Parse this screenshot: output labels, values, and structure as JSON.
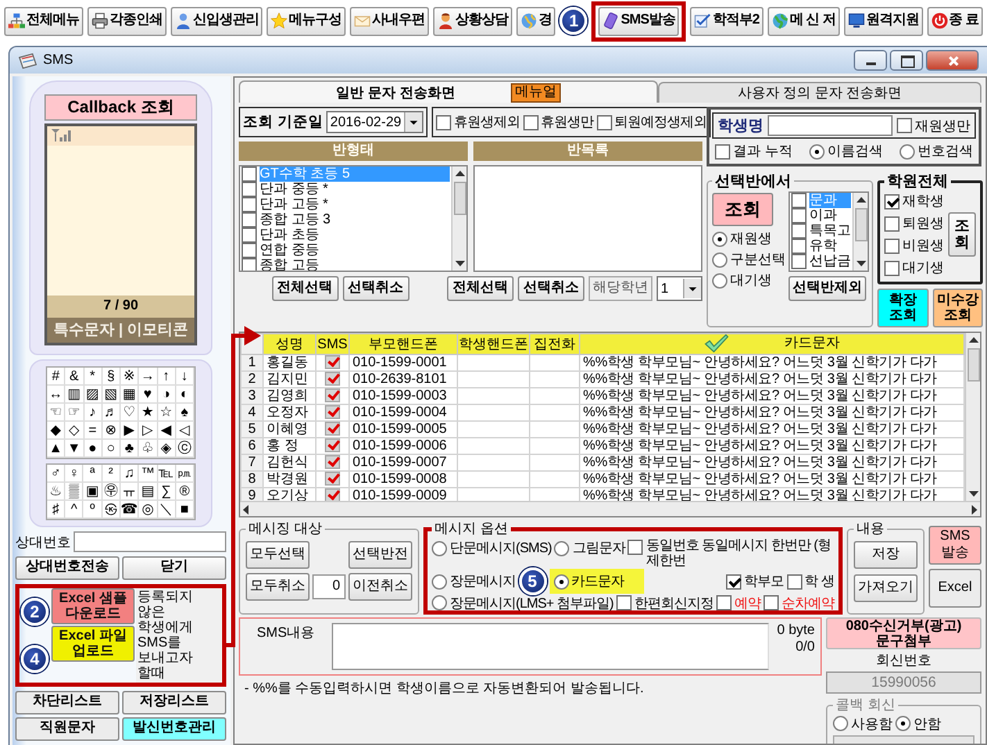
{
  "toolbar": {
    "items": [
      {
        "label": "전체메뉴",
        "highlighted": false
      },
      {
        "label": "각종인쇄",
        "highlighted": false
      },
      {
        "label": "신입생관리",
        "highlighted": false
      },
      {
        "label": "메뉴구성",
        "highlighted": false
      },
      {
        "label": "사내우편",
        "highlighted": false
      },
      {
        "label": "상황상담",
        "highlighted": false
      },
      {
        "label": "경",
        "highlighted": false
      },
      {
        "label": "SMS발송",
        "highlighted": true
      },
      {
        "label": "학적부2",
        "highlighted": false
      },
      {
        "label": "메 신 저",
        "highlighted": false
      },
      {
        "label": "원격지원",
        "highlighted": false
      },
      {
        "label": "종 료",
        "highlighted": false
      }
    ]
  },
  "callouts": [
    {
      "number": "1"
    },
    {
      "number": "2"
    },
    {
      "number": "4"
    },
    {
      "number": "5"
    }
  ],
  "window": {
    "title": "SMS"
  },
  "phone": {
    "title": "Callback 조회",
    "counter": "7 / 90",
    "tabs_label": "특수문자 | 이모티콘",
    "symbol_grid_1": [
      [
        "#",
        "&",
        "*",
        "§",
        "※",
        "→",
        "↑",
        "↓"
      ],
      [
        "↔",
        "▥",
        "▨",
        "▧",
        "▦",
        "♥",
        "◑",
        "◐"
      ],
      [
        "☜",
        "☞",
        "♪",
        "♬",
        "♡",
        "★",
        "☆",
        "♠"
      ],
      [
        "◆",
        "◇",
        "=",
        "⊗",
        "▶",
        "▷",
        "◀",
        "◁"
      ],
      [
        "▲",
        "▼",
        "●",
        "○",
        "♣",
        "♧",
        "◈",
        "ⓒ"
      ]
    ],
    "symbol_grid_2": [
      [
        "♂",
        "♀",
        "ª",
        "²",
        "♫",
        "™",
        "℡",
        "㏘"
      ],
      [
        "♨",
        "▒",
        "▣",
        "㉾",
        "ㅠ",
        "▤",
        "∑",
        "®"
      ],
      [
        "♯",
        "^",
        "º",
        "㉿",
        "☎",
        "◎",
        "＼",
        "■"
      ]
    ],
    "recipient_label": "상대번호",
    "buttons": [
      "상대번호전송",
      "닫기"
    ],
    "excel": {
      "highlighted": true,
      "buttons": [
        {
          "label": "Excel 샘플 다운로드",
          "color": "#f28080"
        },
        {
          "label": "Excel 파일 업로드",
          "color": "#f0f000"
        }
      ],
      "note": "등록되지 않은 학생에게 SMS를 보내고자 할때"
    },
    "bottom_buttons": [
      {
        "label": "차단리스트",
        "color": "#ececec"
      },
      {
        "label": "저장리스트",
        "color": "#ececec"
      },
      {
        "label": "직원문자",
        "color": "#ececec"
      },
      {
        "label": "발신번호관리",
        "color": "#80ffff"
      }
    ]
  },
  "tabs": [
    {
      "label": "일반 문자 전송화면",
      "selected": true,
      "badge": "메뉴얼"
    },
    {
      "label": "사용자 정의 문자 전송화면",
      "selected": false
    }
  ],
  "filter": {
    "date_label": "조회 기준일",
    "date": "2016-02-29",
    "checkboxes": [
      {
        "label": "휴원생제외",
        "checked": false
      },
      {
        "label": "휴원생만",
        "checked": false
      },
      {
        "label": "퇴원예정생제외",
        "checked": false
      }
    ]
  },
  "student_search": {
    "label": "학생명",
    "active_only": {
      "label": "재원생만",
      "checked": false
    },
    "accumulate": {
      "label": "결과 누적",
      "checked": false
    },
    "modes": [
      {
        "label": "이름검색",
        "selected": true
      },
      {
        "label": "번호검색",
        "selected": false
      }
    ]
  },
  "class_types": {
    "header": "반형태",
    "items": [
      {
        "label": "GT수학 초등 5",
        "selected": true,
        "checked": false
      },
      {
        "label": "단과 중등 *",
        "selected": false,
        "checked": false
      },
      {
        "label": "단과 고등 *",
        "selected": false,
        "checked": false
      },
      {
        "label": "종합 고등 3",
        "selected": false,
        "checked": false
      },
      {
        "label": "단과 초등",
        "selected": false,
        "checked": false
      },
      {
        "label": "연합 중등",
        "selected": false,
        "checked": false
      },
      {
        "label": "종합 고등",
        "selected": false,
        "checked": false
      }
    ],
    "buttons": [
      "전체선택",
      "선택취소"
    ]
  },
  "class_list": {
    "header": "반목록",
    "buttons": [
      "전체선택",
      "선택취소"
    ],
    "grade_label": "해당학년",
    "grade": "1"
  },
  "selected_class": {
    "title": "선택반에서",
    "button": "조회",
    "statuses": [
      {
        "label": "재원생",
        "selected": true
      },
      {
        "label": "구분선택",
        "selected": false
      },
      {
        "label": "대기생",
        "selected": false
      }
    ],
    "categories": [
      {
        "label": "문과",
        "selected": true,
        "checked": false
      },
      {
        "label": "이과",
        "selected": false,
        "checked": false
      },
      {
        "label": "특목고",
        "selected": false,
        "checked": false
      },
      {
        "label": "유학",
        "selected": false,
        "checked": false
      },
      {
        "label": "선납금",
        "selected": false,
        "checked": false
      }
    ],
    "exclude_button": "선택반제외"
  },
  "academy": {
    "title": "학원전체",
    "statuses": [
      {
        "label": "재학생",
        "checked": true
      },
      {
        "label": "퇴원생",
        "checked": false
      },
      {
        "label": "비원생",
        "checked": false
      },
      {
        "label": "대기생",
        "checked": false
      }
    ],
    "button": "조회"
  },
  "extra_buttons": [
    {
      "label": "확장 조회",
      "color": "#00ffff"
    },
    {
      "label": "미수강 조회",
      "color": "#ffc080"
    }
  ],
  "table": {
    "columns": [
      "성명",
      "SMS",
      "부모핸드폰",
      "학생핸드폰",
      "집전화",
      "카드문자"
    ],
    "rows": [
      {
        "number": "1",
        "name": "홍길동",
        "sms": true,
        "parent_phone": "010-1599-0001",
        "message": "%%학생 학부모님~ 안녕하세요? 어느덧 3월 신학기가 다가"
      },
      {
        "number": "2",
        "name": "김지민",
        "sms": true,
        "parent_phone": "010-2639-8101",
        "message": "%%학생 학부모님~ 안녕하세요? 어느덧 3월 신학기가 다가"
      },
      {
        "number": "3",
        "name": "김영희",
        "sms": true,
        "parent_phone": "010-1599-0003",
        "message": "%%학생 학부모님~ 안녕하세요? 어느덧 3월 신학기가 다가"
      },
      {
        "number": "4",
        "name": "오정자",
        "sms": true,
        "parent_phone": "010-1599-0004",
        "message": "%%학생 학부모님~ 안녕하세요? 어느덧 3월 신학기가 다가"
      },
      {
        "number": "5",
        "name": "이혜영",
        "sms": true,
        "parent_phone": "010-1599-0005",
        "message": "%%학생 학부모님~ 안녕하세요? 어느덧 3월 신학기가 다가"
      },
      {
        "number": "6",
        "name": "홍 정",
        "sms": true,
        "parent_phone": "010-1599-0006",
        "message": "%%학생 학부모님~ 안녕하세요? 어느덧 3월 신학기가 다가"
      },
      {
        "number": "7",
        "name": "김헌식",
        "sms": true,
        "parent_phone": "010-1599-0007",
        "message": "%%학생 학부모님~ 안녕하세요? 어느덧 3월 신학기가 다가"
      },
      {
        "number": "8",
        "name": "박경원",
        "sms": true,
        "parent_phone": "010-1599-0008",
        "message": "%%학생 학부모님~ 안녕하세요? 어느덧 3월 신학기가 다가"
      },
      {
        "number": "9",
        "name": "오기상",
        "sms": true,
        "parent_phone": "010-1599-0009",
        "message": "%%학생 학부모님~ 안녕하세요? 어느덧 3월 신학기가 다가"
      }
    ]
  },
  "messaging_target": {
    "title": "메시징 대상",
    "buttons": [
      "모두선택",
      "선택반전",
      "모두취소",
      "이전취소"
    ],
    "count": "0"
  },
  "message_options": {
    "title": "메시지 옵션",
    "highlighted": true,
    "types": [
      {
        "label": "단문메시지(SMS)",
        "selected": false,
        "highlighted": false
      },
      {
        "label": "그림문자",
        "selected": false,
        "highlighted": false
      },
      {
        "label": "장문메시지",
        "selected": false,
        "highlighted": false
      },
      {
        "label": "카드문자",
        "selected": true,
        "highlighted": true
      },
      {
        "label": "장문메시지(LMS+ 첨부파일)",
        "selected": false,
        "highlighted": false
      }
    ],
    "options": [
      {
        "label": "동일번호 동일메시지 한번만 (형제한번",
        "checked": false,
        "kind": "normal"
      },
      {
        "label": "학부모",
        "checked": true,
        "kind": "normal"
      },
      {
        "label": "학 생",
        "checked": false,
        "kind": "normal"
      },
      {
        "label": "한편회신지정",
        "checked": false,
        "kind": "normal"
      },
      {
        "label": "예약",
        "checked": false,
        "kind": "warning"
      },
      {
        "label": "순차예약",
        "checked": false,
        "kind": "warning"
      }
    ]
  },
  "content": {
    "title": "내용",
    "buttons": [
      "저장",
      "가져오기"
    ]
  },
  "send_buttons": [
    {
      "label": "SMS 발송",
      "color": "#ffb8b8"
    },
    {
      "label": "Excel",
      "color": "#ececec"
    }
  ],
  "sms_content": {
    "label": "SMS내용",
    "bytes": "0 byte",
    "count": "0/0"
  },
  "optout_button": "080수신거부(광고) 문구첨부",
  "reply_number": {
    "label": "회신번호",
    "value": "15990056",
    "disabled": true
  },
  "callback_reply": {
    "title": "콜백 회신",
    "options": [
      {
        "label": "사용함",
        "selected": false
      },
      {
        "label": "안함",
        "selected": true
      }
    ]
  },
  "note": "- %%를 수동입력하시면 학생이름으로 자동변환되어 발송됩니다."
}
